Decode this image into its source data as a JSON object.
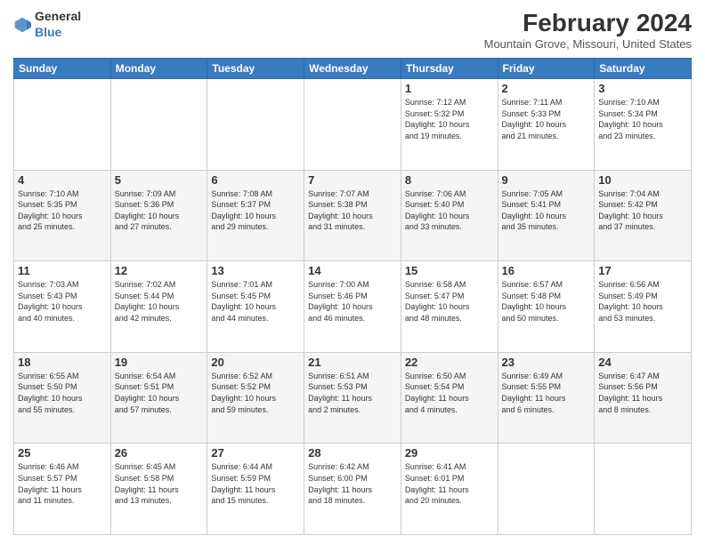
{
  "logo": {
    "general": "General",
    "blue": "Blue"
  },
  "header": {
    "title": "February 2024",
    "subtitle": "Mountain Grove, Missouri, United States"
  },
  "calendar": {
    "headers": [
      "Sunday",
      "Monday",
      "Tuesday",
      "Wednesday",
      "Thursday",
      "Friday",
      "Saturday"
    ],
    "rows": [
      [
        {
          "day": "",
          "info": ""
        },
        {
          "day": "",
          "info": ""
        },
        {
          "day": "",
          "info": ""
        },
        {
          "day": "",
          "info": ""
        },
        {
          "day": "1",
          "info": "Sunrise: 7:12 AM\nSunset: 5:32 PM\nDaylight: 10 hours\nand 19 minutes."
        },
        {
          "day": "2",
          "info": "Sunrise: 7:11 AM\nSunset: 5:33 PM\nDaylight: 10 hours\nand 21 minutes."
        },
        {
          "day": "3",
          "info": "Sunrise: 7:10 AM\nSunset: 5:34 PM\nDaylight: 10 hours\nand 23 minutes."
        }
      ],
      [
        {
          "day": "4",
          "info": "Sunrise: 7:10 AM\nSunset: 5:35 PM\nDaylight: 10 hours\nand 25 minutes."
        },
        {
          "day": "5",
          "info": "Sunrise: 7:09 AM\nSunset: 5:36 PM\nDaylight: 10 hours\nand 27 minutes."
        },
        {
          "day": "6",
          "info": "Sunrise: 7:08 AM\nSunset: 5:37 PM\nDaylight: 10 hours\nand 29 minutes."
        },
        {
          "day": "7",
          "info": "Sunrise: 7:07 AM\nSunset: 5:38 PM\nDaylight: 10 hours\nand 31 minutes."
        },
        {
          "day": "8",
          "info": "Sunrise: 7:06 AM\nSunset: 5:40 PM\nDaylight: 10 hours\nand 33 minutes."
        },
        {
          "day": "9",
          "info": "Sunrise: 7:05 AM\nSunset: 5:41 PM\nDaylight: 10 hours\nand 35 minutes."
        },
        {
          "day": "10",
          "info": "Sunrise: 7:04 AM\nSunset: 5:42 PM\nDaylight: 10 hours\nand 37 minutes."
        }
      ],
      [
        {
          "day": "11",
          "info": "Sunrise: 7:03 AM\nSunset: 5:43 PM\nDaylight: 10 hours\nand 40 minutes."
        },
        {
          "day": "12",
          "info": "Sunrise: 7:02 AM\nSunset: 5:44 PM\nDaylight: 10 hours\nand 42 minutes."
        },
        {
          "day": "13",
          "info": "Sunrise: 7:01 AM\nSunset: 5:45 PM\nDaylight: 10 hours\nand 44 minutes."
        },
        {
          "day": "14",
          "info": "Sunrise: 7:00 AM\nSunset: 5:46 PM\nDaylight: 10 hours\nand 46 minutes."
        },
        {
          "day": "15",
          "info": "Sunrise: 6:58 AM\nSunset: 5:47 PM\nDaylight: 10 hours\nand 48 minutes."
        },
        {
          "day": "16",
          "info": "Sunrise: 6:57 AM\nSunset: 5:48 PM\nDaylight: 10 hours\nand 50 minutes."
        },
        {
          "day": "17",
          "info": "Sunrise: 6:56 AM\nSunset: 5:49 PM\nDaylight: 10 hours\nand 53 minutes."
        }
      ],
      [
        {
          "day": "18",
          "info": "Sunrise: 6:55 AM\nSunset: 5:50 PM\nDaylight: 10 hours\nand 55 minutes."
        },
        {
          "day": "19",
          "info": "Sunrise: 6:54 AM\nSunset: 5:51 PM\nDaylight: 10 hours\nand 57 minutes."
        },
        {
          "day": "20",
          "info": "Sunrise: 6:52 AM\nSunset: 5:52 PM\nDaylight: 10 hours\nand 59 minutes."
        },
        {
          "day": "21",
          "info": "Sunrise: 6:51 AM\nSunset: 5:53 PM\nDaylight: 11 hours\nand 2 minutes."
        },
        {
          "day": "22",
          "info": "Sunrise: 6:50 AM\nSunset: 5:54 PM\nDaylight: 11 hours\nand 4 minutes."
        },
        {
          "day": "23",
          "info": "Sunrise: 6:49 AM\nSunset: 5:55 PM\nDaylight: 11 hours\nand 6 minutes."
        },
        {
          "day": "24",
          "info": "Sunrise: 6:47 AM\nSunset: 5:56 PM\nDaylight: 11 hours\nand 8 minutes."
        }
      ],
      [
        {
          "day": "25",
          "info": "Sunrise: 6:46 AM\nSunset: 5:57 PM\nDaylight: 11 hours\nand 11 minutes."
        },
        {
          "day": "26",
          "info": "Sunrise: 6:45 AM\nSunset: 5:58 PM\nDaylight: 11 hours\nand 13 minutes."
        },
        {
          "day": "27",
          "info": "Sunrise: 6:44 AM\nSunset: 5:59 PM\nDaylight: 11 hours\nand 15 minutes."
        },
        {
          "day": "28",
          "info": "Sunrise: 6:42 AM\nSunset: 6:00 PM\nDaylight: 11 hours\nand 18 minutes."
        },
        {
          "day": "29",
          "info": "Sunrise: 6:41 AM\nSunset: 6:01 PM\nDaylight: 11 hours\nand 20 minutes."
        },
        {
          "day": "",
          "info": ""
        },
        {
          "day": "",
          "info": ""
        }
      ]
    ]
  }
}
